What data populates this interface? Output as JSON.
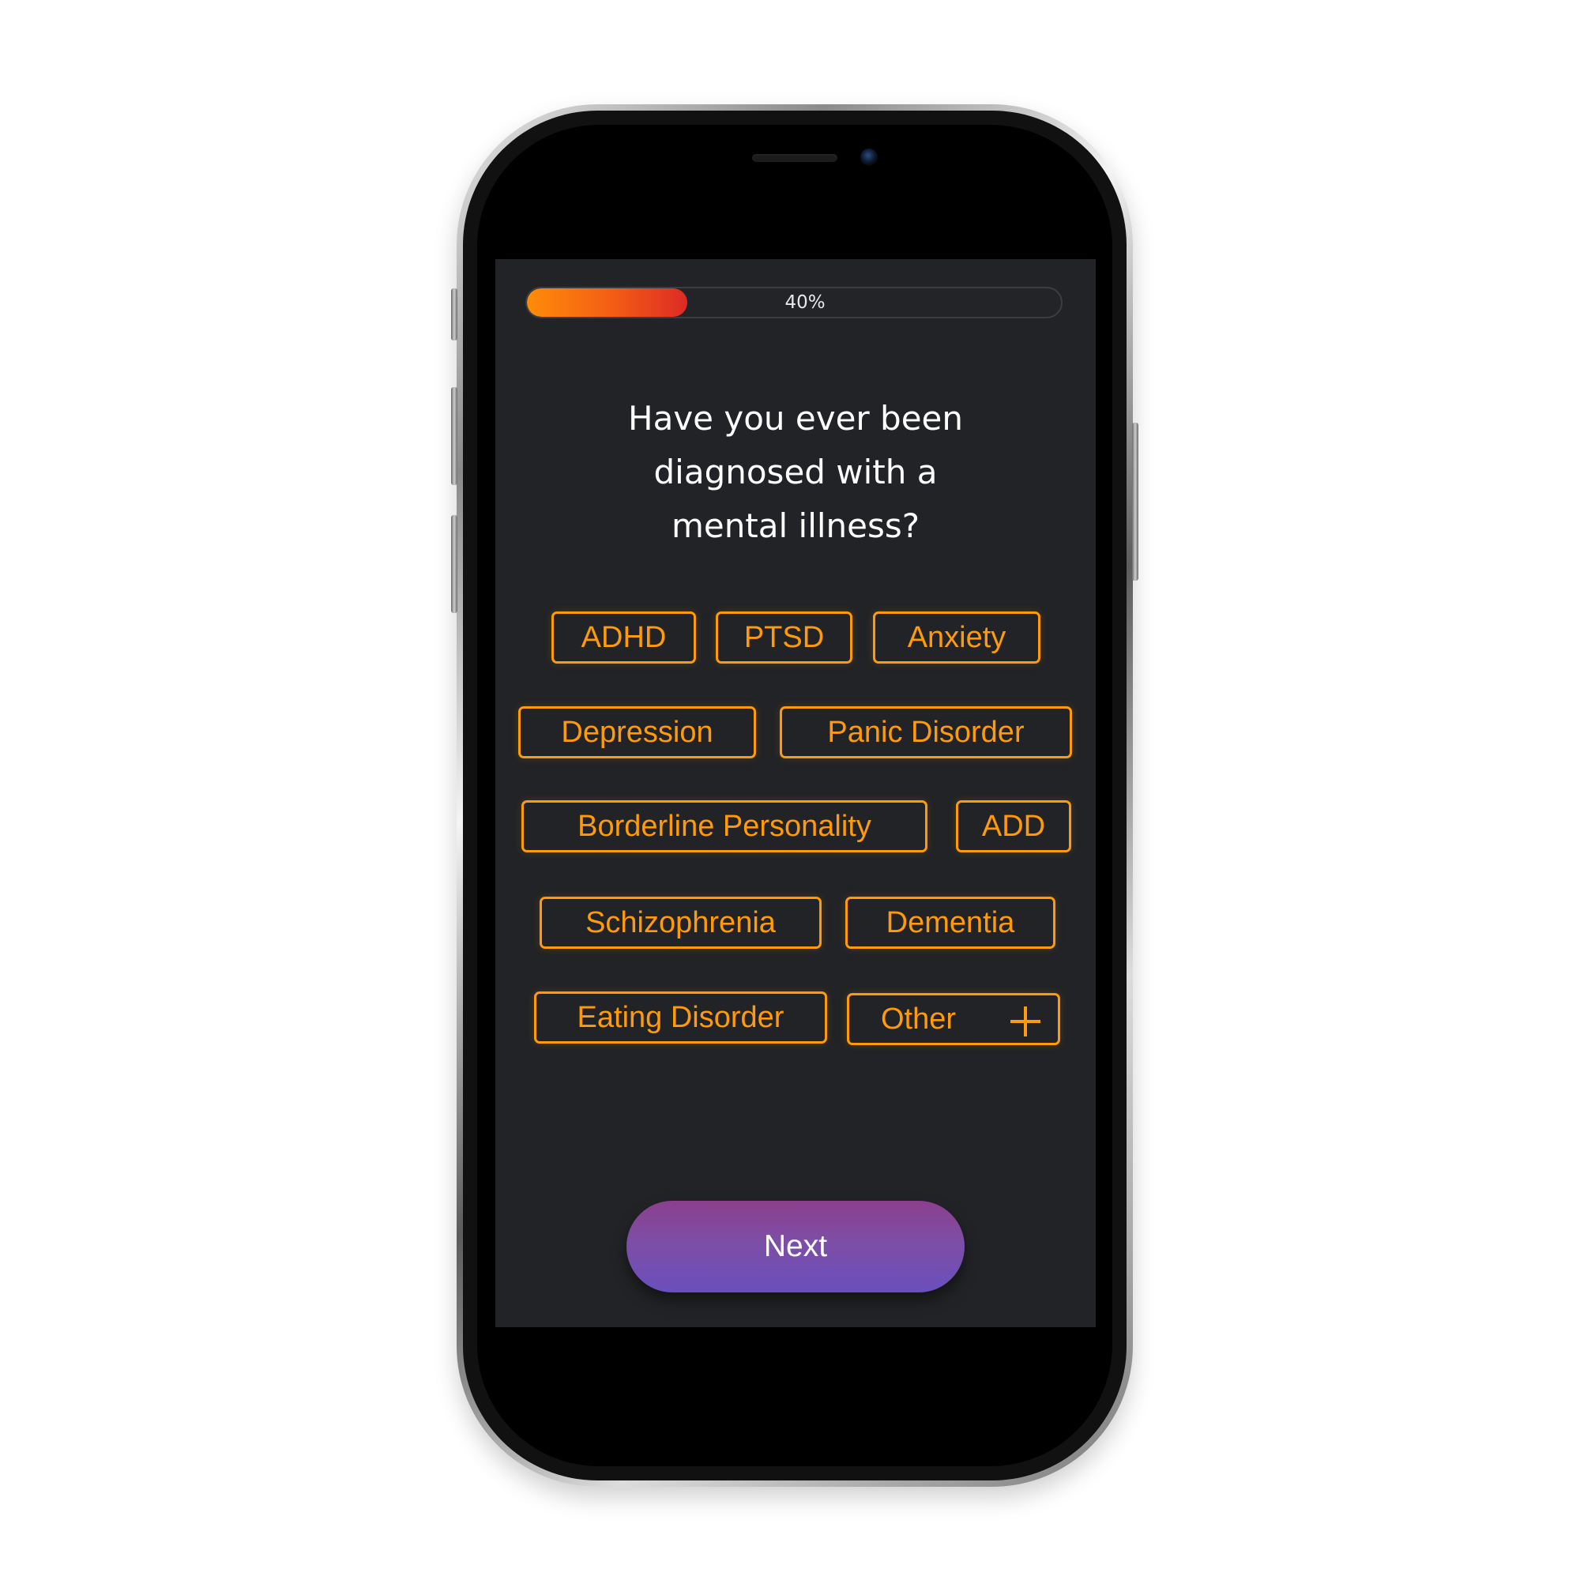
{
  "progress": {
    "value": 0.3,
    "label": "40%"
  },
  "question": {
    "line1": "Have you ever been",
    "line2": "diagnosed with a",
    "line3": "mental illness?"
  },
  "options": [
    {
      "label": "ADHD"
    },
    {
      "label": "PTSD"
    },
    {
      "label": "Anxiety"
    },
    {
      "label": "Depression"
    },
    {
      "label": "Panic Disorder"
    },
    {
      "label": "Borderline Personality"
    },
    {
      "label": "ADD"
    },
    {
      "label": "Schizophrenia"
    },
    {
      "label": "Dementia"
    },
    {
      "label": "Eating Disorder"
    },
    {
      "label": "Other",
      "icon": "plus-icon"
    }
  ],
  "next_button": {
    "label": "Next"
  },
  "colors": {
    "accent": "#ff9b08",
    "screen_background": "#222326",
    "progress_start": "#ff8c08",
    "progress_end": "#dd2a25",
    "button_top": "#8b3f8d",
    "button_bottom": "#6a4fbd"
  }
}
